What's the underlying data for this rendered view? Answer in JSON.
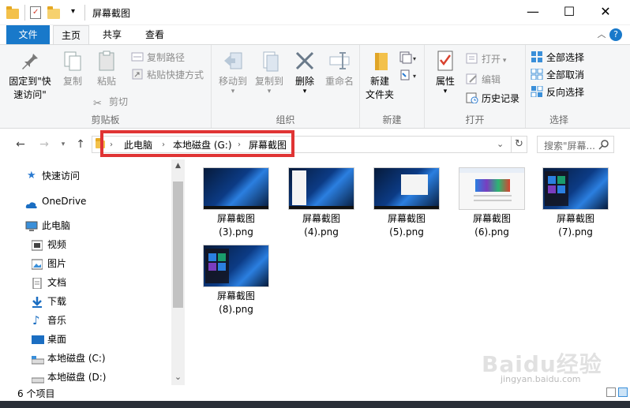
{
  "window": {
    "title": "屏幕截图",
    "minimize_glyph": "—",
    "maximize_glyph": "☐",
    "close_glyph": "✕"
  },
  "tabs": {
    "file": "文件",
    "home": "主页",
    "share": "共享",
    "view": "查看"
  },
  "ribbon": {
    "clipboard": {
      "label": "剪贴板",
      "pin_line1": "固定到\"快",
      "pin_line2": "速访问\"",
      "copy": "复制",
      "paste": "粘贴",
      "copy_path": "复制路径",
      "paste_shortcut": "粘贴快捷方式",
      "cut": "剪切"
    },
    "organize": {
      "label": "组织",
      "move_to": "移动到",
      "copy_to": "复制到",
      "delete": "删除",
      "rename": "重命名"
    },
    "new": {
      "label": "新建",
      "new_folder_line1": "新建",
      "new_folder_line2": "文件夹"
    },
    "open": {
      "label": "打开",
      "properties": "属性",
      "open": "打开",
      "edit": "编辑",
      "history": "历史记录"
    },
    "select": {
      "label": "选择",
      "select_all": "全部选择",
      "select_none": "全部取消",
      "invert": "反向选择"
    }
  },
  "address": {
    "crumbs": [
      "此电脑",
      "本地磁盘 (G:)",
      "屏幕截图"
    ],
    "search_placeholder": "搜索\"屏幕..."
  },
  "nav": {
    "items": [
      {
        "label": "快速访问",
        "icon": "star-icon"
      },
      {
        "label": "OneDrive",
        "icon": "cloud-icon"
      },
      {
        "label": "此电脑",
        "icon": "computer-icon"
      },
      {
        "label": "视频",
        "icon": "video-icon"
      },
      {
        "label": "图片",
        "icon": "picture-icon"
      },
      {
        "label": "文档",
        "icon": "document-icon"
      },
      {
        "label": "下载",
        "icon": "download-icon"
      },
      {
        "label": "音乐",
        "icon": "music-icon"
      },
      {
        "label": "桌面",
        "icon": "desktop-icon"
      },
      {
        "label": "本地磁盘 (C:)",
        "icon": "drive-icon"
      },
      {
        "label": "本地磁盘 (D:)",
        "icon": "drive-icon"
      }
    ]
  },
  "files": [
    {
      "line1": "屏幕截图",
      "line2": "(3).png"
    },
    {
      "line1": "屏幕截图",
      "line2": "(4).png"
    },
    {
      "line1": "屏幕截图",
      "line2": "(5).png"
    },
    {
      "line1": "屏幕截图",
      "line2": "(6).png"
    },
    {
      "line1": "屏幕截图",
      "line2": "(7).png"
    },
    {
      "line1": "屏幕截图",
      "line2": "(8).png"
    }
  ],
  "status": {
    "count": "6 个项目"
  },
  "watermark": {
    "brand": "Baidu经验",
    "url": "jingyan.baidu.com"
  },
  "colors": {
    "accent": "#1979ca",
    "highlight": "#e03434"
  }
}
